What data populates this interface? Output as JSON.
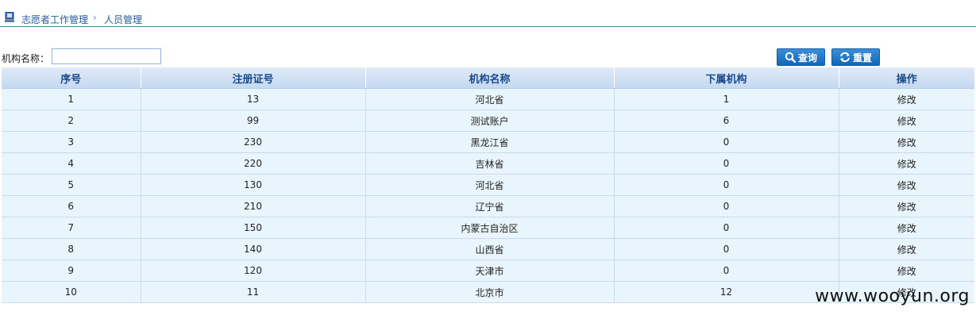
{
  "breadcrumb": {
    "root": "志愿者工作管理",
    "separator": "›",
    "current": "人员管理"
  },
  "search": {
    "label": "机构名称：",
    "value": "",
    "placeholder": ""
  },
  "buttons": {
    "search_label": "查询",
    "reset_label": "重置"
  },
  "table": {
    "headers": [
      "序号",
      "注册证号",
      "机构名称",
      "下属机构",
      "操作"
    ],
    "rows": [
      [
        "1",
        "13",
        "河北省",
        "1",
        "修改"
      ],
      [
        "2",
        "99",
        "测试账户",
        "6",
        "修改"
      ],
      [
        "3",
        "230",
        "黑龙江省",
        "0",
        "修改"
      ],
      [
        "4",
        "220",
        "吉林省",
        "0",
        "修改"
      ],
      [
        "5",
        "130",
        "河北省",
        "0",
        "修改"
      ],
      [
        "6",
        "210",
        "辽宁省",
        "0",
        "修改"
      ],
      [
        "7",
        "150",
        "内蒙古自治区",
        "0",
        "修改"
      ],
      [
        "8",
        "140",
        "山西省",
        "0",
        "修改"
      ],
      [
        "9",
        "120",
        "天津市",
        "0",
        "修改"
      ],
      [
        "10",
        "11",
        "北京市",
        "12",
        "修改"
      ]
    ]
  },
  "watermark": "www.wooyun.org",
  "colors": {
    "header_text": "#1a4a8a",
    "row_bg": "#e9f5fc",
    "button_bg": "#1067b8",
    "breadcrumb_link": "#2a5a9a"
  }
}
